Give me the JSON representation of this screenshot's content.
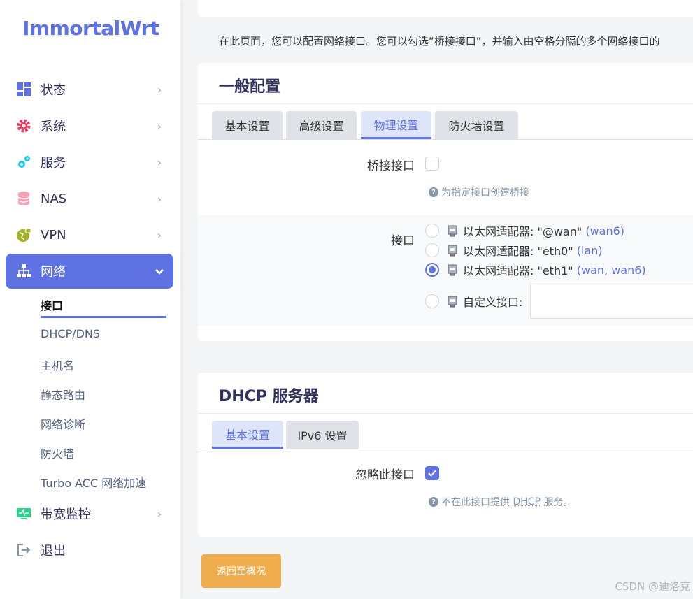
{
  "logo": "ImmortalWrt",
  "sidebar": {
    "items": [
      {
        "label": "状态",
        "icon": "dashboard-icon"
      },
      {
        "label": "系统",
        "icon": "gear-icon"
      },
      {
        "label": "服务",
        "icon": "cogs-icon"
      },
      {
        "label": "NAS",
        "icon": "database-icon"
      },
      {
        "label": "VPN",
        "icon": "globe-lock-icon"
      },
      {
        "label": "网络",
        "icon": "sitemap-icon"
      },
      {
        "label": "带宽监控",
        "icon": "monitor-icon"
      },
      {
        "label": "退出",
        "icon": "logout-icon"
      }
    ],
    "network_sub": [
      "接口",
      "DHCP/DNS",
      "主机名",
      "静态路由",
      "网络诊断",
      "防火墙",
      "Turbo ACC 网络加速"
    ]
  },
  "page": {
    "description": "在此页面，您可以配置网络接口。您可以勾选“桥接接口”，并输入由空格分隔的多个网络接口的"
  },
  "general": {
    "title": "一般配置",
    "tabs": [
      "基本设置",
      "高级设置",
      "物理设置",
      "防火墙设置"
    ],
    "bridge_label": "桥接接口",
    "bridge_hint": "为指定接口创建桥接",
    "iface_label": "接口",
    "ifaces": [
      {
        "name": "以太网适配器: \"@wan\"",
        "nets": "(wan6)",
        "nets_inner": "wan6"
      },
      {
        "name": "以太网适配器: \"eth0\"",
        "nets": "(lan)",
        "nets_inner": "lan"
      },
      {
        "name": "以太网适配器: \"eth1\"",
        "nets": "(wan, wan6)",
        "nets_inner": "wan, wan6"
      }
    ],
    "custom_label": "自定义接口:",
    "paren_open": "(",
    "paren_close": ")"
  },
  "dhcp": {
    "title": "DHCP 服务器",
    "tabs": [
      "基本设置",
      "IPv6 设置"
    ],
    "ignore_label": "忽略此接口",
    "hint_pre": "不在此接口提供",
    "hint_abbr": "DHCP",
    "hint_post": "服务。"
  },
  "back_button": "返回至概况",
  "watermark": "CSDN @迪洛克",
  "colors": {
    "accent": "#5e72e4",
    "button": "#f0ad4e"
  }
}
